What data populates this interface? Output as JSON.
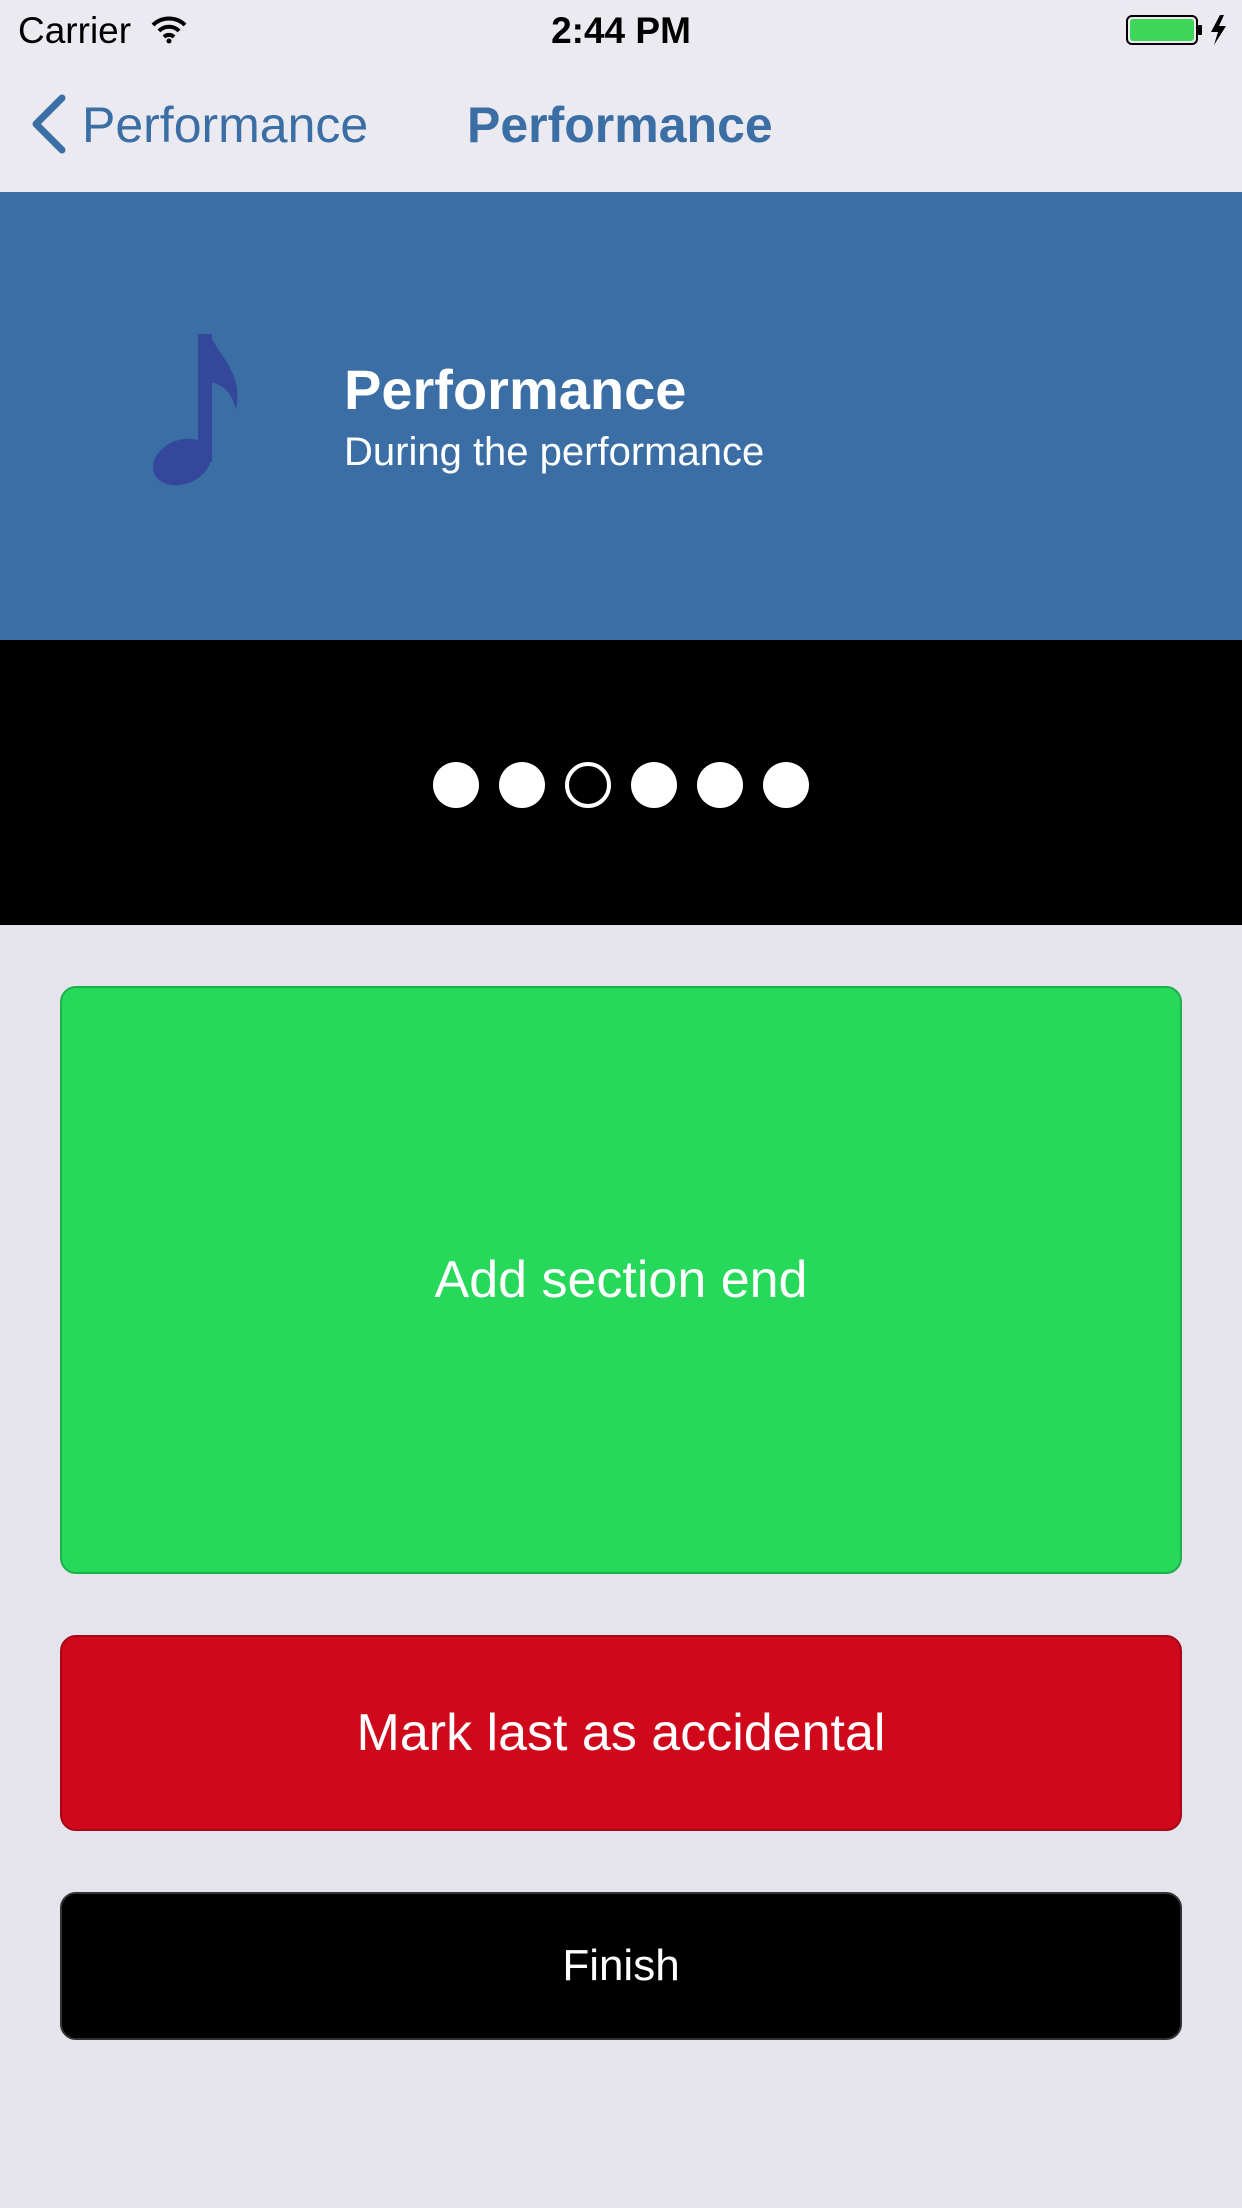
{
  "status_bar": {
    "carrier": "Carrier",
    "time": "2:44 PM"
  },
  "nav": {
    "back_label": "Performance",
    "title": "Performance"
  },
  "header": {
    "title": "Performance",
    "subtitle": "During the performance"
  },
  "pager": {
    "page_count": 6,
    "current_page": 3
  },
  "buttons": {
    "add_section_end": "Add section end",
    "mark_accidental": "Mark last as accidental",
    "finish": "Finish"
  },
  "colors": {
    "accent": "#3a6ea5",
    "add_button": "#26d95a",
    "mark_button": "#d0081c",
    "finish_button": "#000000"
  },
  "icons": [
    "wifi-icon",
    "battery-icon",
    "back-chevron-icon",
    "music-note-icon"
  ]
}
